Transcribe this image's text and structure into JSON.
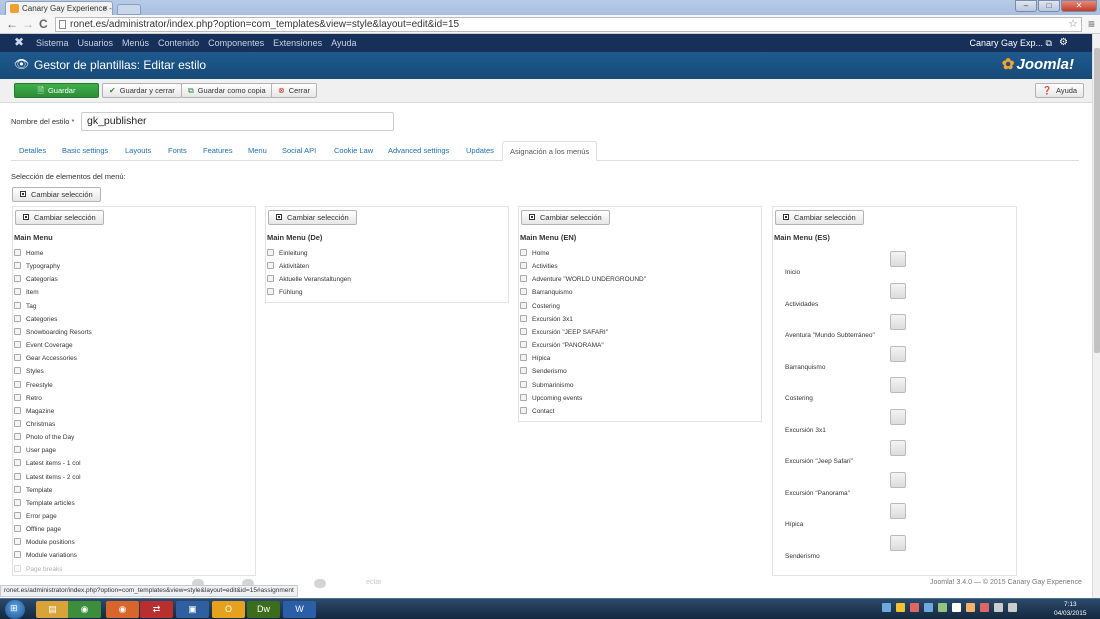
{
  "browser": {
    "tab_title": "Canary Gay Experience - J",
    "tab_close": "×",
    "window_controls": [
      "–",
      "□",
      "✕"
    ],
    "url": "ronet.es/administrator/index.php?option=com_templates&view=style&layout=edit&id=15",
    "status_url": "ronet.es/administrator/index.php?option=com_templates&view=style&layout=edit&id=15#assignment",
    "nav": {
      "back": "←",
      "forward": "→",
      "reload": "C"
    },
    "star": "☆",
    "menu": "≡"
  },
  "adminbar": {
    "logo": "✖",
    "menu": [
      "Sistema",
      "Usuarios",
      "Menús",
      "Contenido",
      "Componentes",
      "Extensiones",
      "Ayuda"
    ],
    "site_name": "Canary Gay Exp... ⧉",
    "settings": "⚙"
  },
  "header": {
    "icon": "👁",
    "title": "Gestor de plantillas: Editar estilo",
    "brand_flower": "✿",
    "brand": "Joomla!"
  },
  "toolbar": {
    "save": "Guardar",
    "save_close": "Guardar y cerrar",
    "save_copy": "Guardar como copia",
    "close": "Cerrar",
    "help": "Ayuda",
    "icons": {
      "save": "🗎",
      "save_close": "✔",
      "save_copy": "⧉",
      "close": "⊗",
      "help": "❓"
    }
  },
  "form": {
    "name_label": "Nombre del estilo *",
    "name_value": "gk_publisher"
  },
  "tabs": [
    "Detalles",
    "Basic settings",
    "Layouts",
    "Fonts",
    "Features",
    "Menu",
    "Social API",
    "Cookie Law",
    "Advanced settings",
    "Updates",
    "Asignación a los menús"
  ],
  "assignment": {
    "selection_label": "Selección de elementos del menú:",
    "toggle_label": "Cambiar selección",
    "menus": [
      {
        "title": "Main Menu",
        "items": [
          "Home",
          "Typography",
          "Categorías",
          "Item",
          "Tag",
          "Categories",
          "Snowboarding Resorts",
          "Event Coverage",
          "Gear Accessories",
          "Styles",
          "Freestyle",
          "Retro",
          "Magazine",
          "Christmas",
          "Photo of the Day",
          "User page",
          "Latest items - 1 col",
          "Latest items - 2 col",
          "Template",
          "Template articles",
          "Error page",
          "Offline page",
          "Module positions",
          "Module variations",
          "Page breaks"
        ]
      },
      {
        "title": "Main Menu (De)",
        "items": [
          "Einleitung",
          "Aktivitäten",
          "Aktuelle Veranstaltungen",
          "Fühlung"
        ]
      },
      {
        "title": "Main Menu (EN)",
        "items": [
          "Home",
          "Activities",
          "Adventure \"WORLD UNDERGROUND\"",
          "Barranquismo",
          "Costering",
          "Excursión 3x1",
          "Excursión \"JEEP SAFARI\"",
          "Excursión \"PANORAMA\"",
          "Hípica",
          "Senderismo",
          "Submarinismo",
          "Upcoming events",
          "Contact"
        ]
      },
      {
        "title": "Main Menu (ES)",
        "items": [
          "Inicio",
          "Actividades",
          "Aventura \"Mundo Subterráneo\"",
          "Barranquismo",
          "Costering",
          "Excursión 3x1",
          "Excursión \"Jeep Safari\"",
          "Excursión \"Panorama\"",
          "Hípica",
          "Senderismo"
        ]
      }
    ]
  },
  "footer": {
    "copyright": "Joomla! 3.4.0 — © 2015 Canary Gay Experience",
    "faded_text": "ectar"
  },
  "taskbar": {
    "start": "⊞",
    "apps": [
      {
        "name": "explorer",
        "color": "#d8a43a",
        "glyph": "▤"
      },
      {
        "name": "chrome",
        "color": "#3c8d3c",
        "glyph": "◉"
      },
      {
        "name": "firefox",
        "color": "#d8662a",
        "glyph": "◉"
      },
      {
        "name": "filezilla",
        "color": "#b92f2f",
        "glyph": "⇄"
      },
      {
        "name": "word-doc",
        "color": "#2f5f9f",
        "glyph": "▣"
      },
      {
        "name": "outlook",
        "color": "#e6a21d",
        "glyph": "O"
      },
      {
        "name": "dreamweaver",
        "color": "#3b6d1d",
        "glyph": "Dw"
      },
      {
        "name": "word",
        "color": "#2a5fa8",
        "glyph": "W"
      }
    ],
    "time": "7:13",
    "date": "04/03/2015"
  }
}
